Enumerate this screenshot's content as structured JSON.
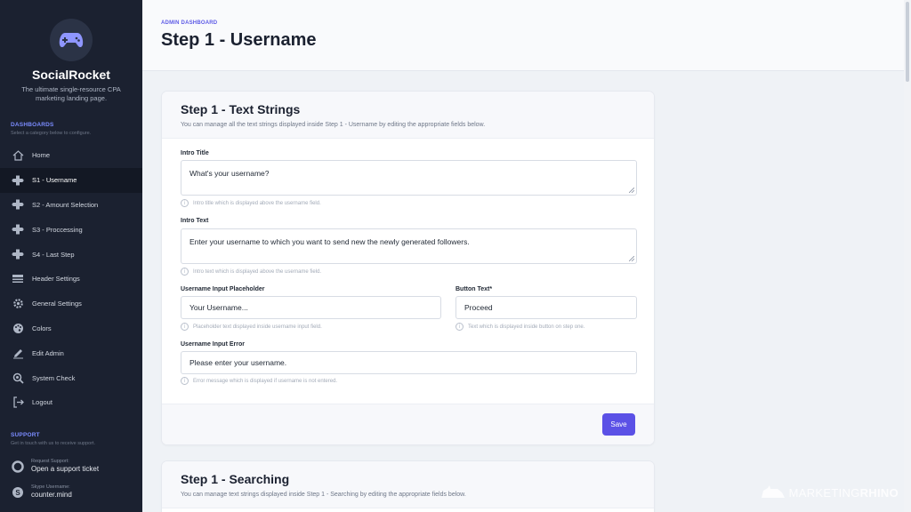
{
  "sidebar": {
    "brand": "SocialRocket",
    "tagline": "The ultimate single-resource CPA marketing landing page.",
    "dashboards_title": "DASHBOARDS",
    "dashboards_sub": "Select a category below to configure.",
    "items": [
      {
        "label": "Home",
        "icon": "home-icon"
      },
      {
        "label": "S1 - Username",
        "icon": "gamepad-icon"
      },
      {
        "label": "S2 - Amount Selection",
        "icon": "gamepad-icon"
      },
      {
        "label": "S3 - Proccessing",
        "icon": "gamepad-icon"
      },
      {
        "label": "S4 - Last Step",
        "icon": "gamepad-icon"
      },
      {
        "label": "Header Settings",
        "icon": "header-icon"
      },
      {
        "label": "General Settings",
        "icon": "gear-icon"
      },
      {
        "label": "Colors",
        "icon": "palette-icon"
      },
      {
        "label": "Edit Admin",
        "icon": "pencil-icon"
      },
      {
        "label": "System Check",
        "icon": "system-check-icon"
      },
      {
        "label": "Logout",
        "icon": "logout-icon"
      }
    ],
    "active_index": 1,
    "support_title": "SUPPORT",
    "support_sub": "Get in touch with us to receive support.",
    "support_ticket_small": "Request Support:",
    "support_ticket": "Open a support ticket",
    "skype_small": "Skype Username:",
    "skype": "counter.mind"
  },
  "header": {
    "breadcrumb": "ADMIN DASHBOARD",
    "title": "Step 1 - Username"
  },
  "card1": {
    "title": "Step 1 - Text Strings",
    "subtitle": "You can manage all the text strings displayed inside Step 1 - Username by editing the appropriate fields below.",
    "fields": {
      "intro_title": {
        "label": "Intro Title",
        "value": "What's your username?",
        "help": "Intro title which is displayed above the username field."
      },
      "intro_text": {
        "label": "Intro Text",
        "value": "Enter your username to which you want to send new the newly generated followers.",
        "help": "Intro text which is displayed above the username field."
      },
      "placeholder": {
        "label": "Username Input Placeholder",
        "value": "Your Username...",
        "help": "Placeholder text displayed inside username input field."
      },
      "button_text": {
        "label": "Button Text*",
        "value": "Proceed",
        "help": "Text which is displayed inside button on step one."
      },
      "input_error": {
        "label": "Username Input Error",
        "value": "Please enter your username.",
        "help": "Error message which is displayed if username is not entered."
      }
    },
    "save_label": "Save"
  },
  "card2": {
    "title": "Step 1 - Searching",
    "subtitle": "You can manage text strings displayed inside Step 1 - Searching by editing the appropriate fields below."
  },
  "watermark": {
    "text_light": "MARKETING",
    "text_bold": "RHINO"
  },
  "colors": {
    "accent": "#5b51e6",
    "sidebar_bg": "#1b2130",
    "breadcrumb": "#5d5ae6"
  }
}
